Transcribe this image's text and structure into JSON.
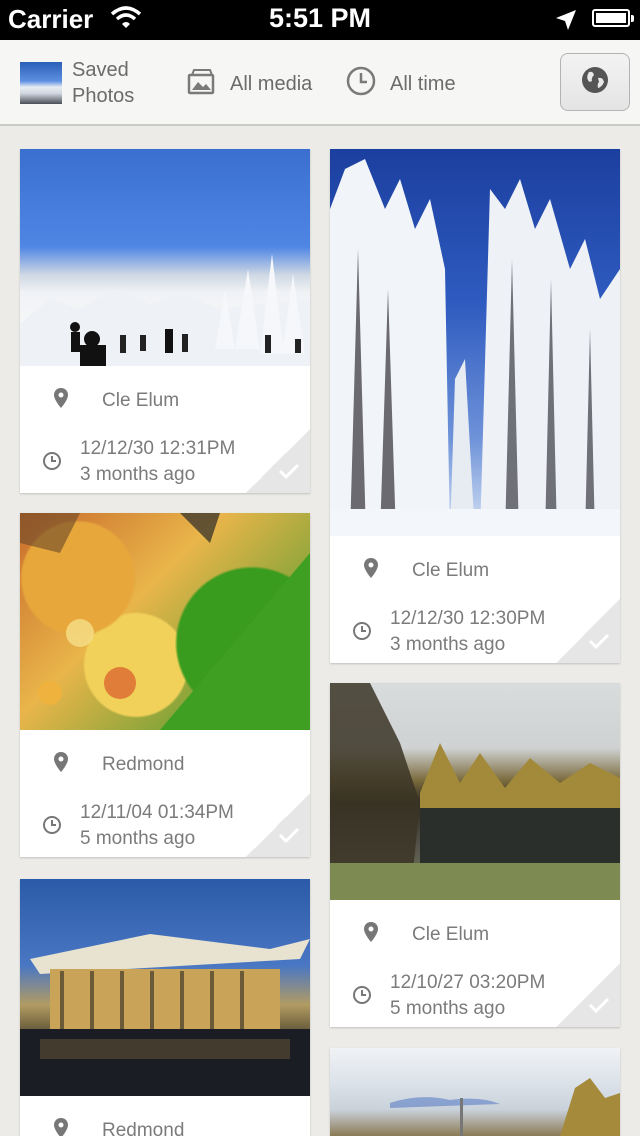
{
  "status_bar": {
    "carrier": "Carrier",
    "time": "5:51 PM"
  },
  "toolbar": {
    "album_label_line1": "Saved",
    "album_label_line2": "Photos",
    "media_filter": "All media",
    "time_filter": "All time",
    "globe_icon": "globe-icon"
  },
  "cards": [
    {
      "place": "Cle Elum",
      "date": "12/12/30 12:31PM",
      "relative": "3 months ago"
    },
    {
      "place": "Cle Elum",
      "date": "12/12/30 12:30PM",
      "relative": "3 months ago"
    },
    {
      "place": "Redmond",
      "date": "12/11/04 01:34PM",
      "relative": "5 months ago"
    },
    {
      "place": "Cle Elum",
      "date": "12/10/27 03:20PM",
      "relative": "5 months ago"
    },
    {
      "place": "Redmond",
      "date": "",
      "relative": ""
    }
  ],
  "colors": {
    "background": "#ecebe8",
    "toolbar": "#f6f6f5",
    "text_muted": "#7b7b7b"
  }
}
